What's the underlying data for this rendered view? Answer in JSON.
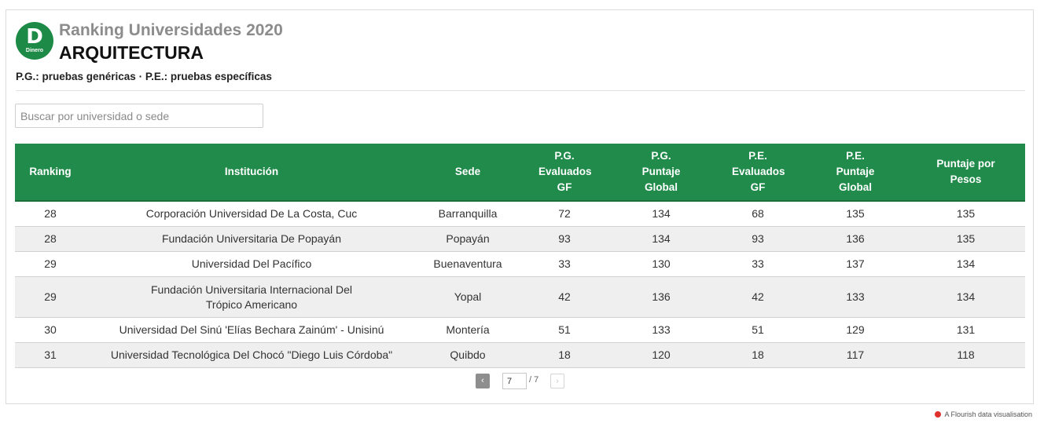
{
  "logo": {
    "letter": "D",
    "text": "Dinero"
  },
  "header": {
    "title": "Ranking Universidades 2020",
    "subtitle": "ARQUITECTURA",
    "legend": "P.G.: pruebas genéricas · P.E.: pruebas específicas"
  },
  "search": {
    "placeholder": "Buscar por universidad o sede",
    "value": ""
  },
  "table": {
    "columns": [
      "Ranking",
      "Institución",
      "Sede",
      "P.G. Evaluados GF",
      "P.G. Puntaje Global",
      "P.E. Evaluados GF",
      "P.E. Puntaje Global",
      "Puntaje por Pesos"
    ],
    "rows": [
      [
        "28",
        "Corporación Universidad De La Costa, Cuc",
        "Barranquilla",
        "72",
        "134",
        "68",
        "135",
        "135"
      ],
      [
        "28",
        "Fundación Universitaria De Popayán",
        "Popayán",
        "93",
        "134",
        "93",
        "136",
        "135"
      ],
      [
        "29",
        "Universidad Del Pacífico",
        "Buenaventura",
        "33",
        "130",
        "33",
        "137",
        "134"
      ],
      [
        "29",
        "Fundación Universitaria Internacional Del Trópico Americano",
        "Yopal",
        "42",
        "136",
        "42",
        "133",
        "134"
      ],
      [
        "30",
        "Universidad Del Sinú 'Elías Bechara Zainúm' - Unisinú",
        "Montería",
        "51",
        "133",
        "51",
        "129",
        "131"
      ],
      [
        "31",
        "Universidad Tecnológica Del Chocó \"Diego Luis Córdoba\"",
        "Quibdo",
        "18",
        "120",
        "18",
        "117",
        "118"
      ]
    ]
  },
  "pagination": {
    "prev": "‹",
    "next": "›",
    "current": "7",
    "total": "/ 7"
  },
  "credit": "A Flourish data visualisation",
  "colors": {
    "header_green": "#208b4a",
    "logo_green": "#1e8a47",
    "credit_dot": "#e0302d"
  }
}
